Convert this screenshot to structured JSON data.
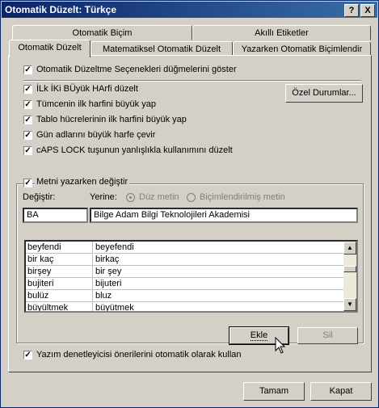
{
  "window": {
    "title": "Otomatik Düzelt: Türkçe",
    "help_label": "?",
    "close_label": "X"
  },
  "tabs_back": [
    "Otomatik Biçim",
    "Akıllı Etiketler"
  ],
  "tabs_front": [
    "Otomatik Düzelt",
    "Matematiksel Otomatik Düzelt",
    "Yazarken Otomatik Biçimlendir"
  ],
  "options": {
    "show_buttons": "Otomatik Düzeltme Seçenekleri düğmelerini göster",
    "two_initials": "İLk İKi BÜyük HArfi düzelt",
    "sentence_first": "Tümcenin ilk harfini büyük yap",
    "table_cells": "Tablo hücrelerinin ilk harfini büyük yap",
    "day_names": "Gün adlarını büyük harfe çevir",
    "caps_lock": "cAPS LOCK tuşunun yanlışlıkla kullanımını düzelt"
  },
  "exceptions_button": "Özel Durumlar...",
  "replace_group": {
    "title": "Metni yazarken değiştir",
    "replace_label": "Değiştir:",
    "with_label": "Yerine:",
    "plain_text": "Düz metin",
    "formatted_text": "Biçimlendirilmiş metin",
    "replace_value": "BA",
    "with_value": "Bilge Adam Bilgi Teknolojileri Akademisi"
  },
  "list": [
    [
      "beyfendi",
      "beyefendi"
    ],
    [
      "bir kaç",
      "birkaç"
    ],
    [
      "birşey",
      "bir şey"
    ],
    [
      "bujiteri",
      "bijuteri"
    ],
    [
      "bulüz",
      "bluz"
    ],
    [
      "büyültmek",
      "büyütmek"
    ]
  ],
  "add_button": "Ekle",
  "delete_button": "Sil",
  "spell_option": "Yazım denetleyicisi önerilerini otomatik olarak kullan",
  "ok_button": "Tamam",
  "cancel_button": "Kapat",
  "colors": {
    "title_start": "#0a246a",
    "title_end": "#3a6ea5",
    "face": "#d4d0c8"
  }
}
